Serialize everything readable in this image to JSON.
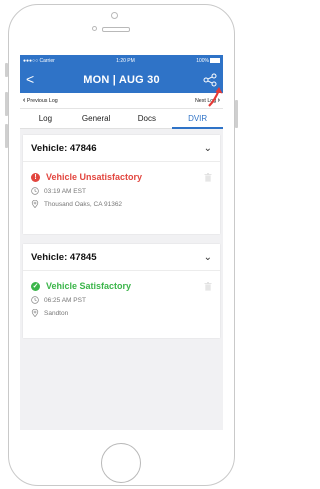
{
  "status_bar": {
    "carrier": "●●●○○ Carrier",
    "time": "1:20 PM",
    "battery": "100%"
  },
  "app_bar": {
    "back_glyph": "<",
    "title": "MON | AUG 30",
    "share_icon": "share-icon"
  },
  "log_nav": {
    "previous": "Previous Log",
    "next": "Next Log"
  },
  "tabs": [
    {
      "label": "Log",
      "active": false
    },
    {
      "label": "General",
      "active": false
    },
    {
      "label": "Docs",
      "active": false
    },
    {
      "label": "DVIR",
      "active": true
    }
  ],
  "cards": [
    {
      "vehicle": "Vehicle: 47846",
      "status": "Vehicle Unsatisfactory",
      "status_color": "#e2463f",
      "time": "03:19 AM EST",
      "location": "Thousand Oaks, CA 91362"
    },
    {
      "vehicle": "Vehicle: 47845",
      "status": "Vehicle Satisfactory",
      "status_color": "#3bb54a",
      "time": "06:25 AM PST",
      "location": "Sandton"
    }
  ],
  "colors": {
    "brand": "#2f73c7",
    "highlight_arrow": "#e53935"
  }
}
